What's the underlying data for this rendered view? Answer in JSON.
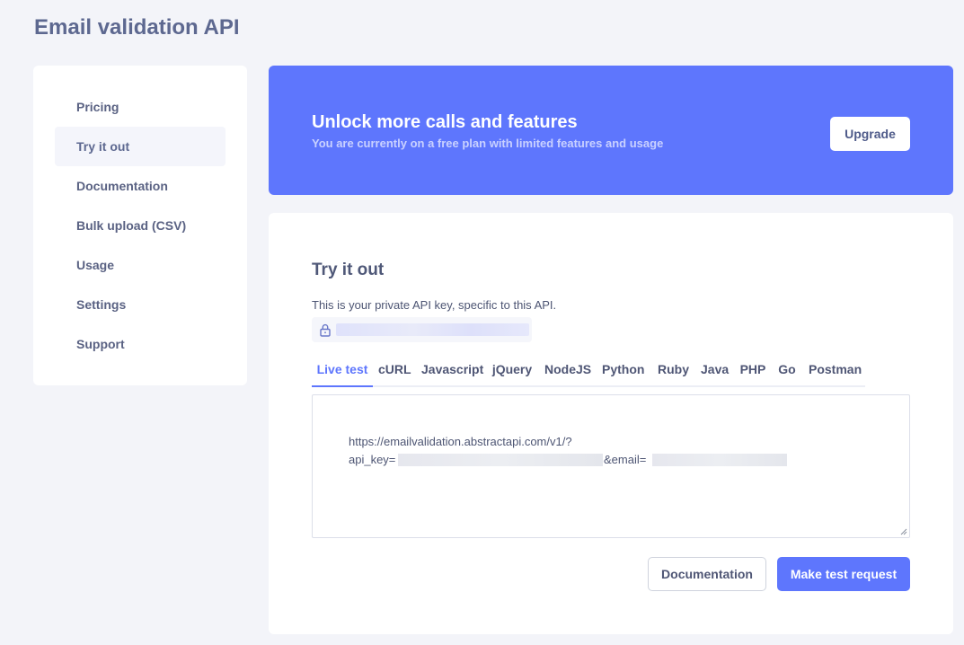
{
  "page": {
    "title": "Email validation API"
  },
  "sidebar": {
    "items": [
      {
        "label": "Pricing",
        "active": false
      },
      {
        "label": "Try it out",
        "active": true
      },
      {
        "label": "Documentation",
        "active": false
      },
      {
        "label": "Bulk upload (CSV)",
        "active": false
      },
      {
        "label": "Usage",
        "active": false
      },
      {
        "label": "Settings",
        "active": false
      },
      {
        "label": "Support",
        "active": false
      }
    ]
  },
  "banner": {
    "title": "Unlock more calls and features",
    "subtitle": "You are currently on a free plan with limited features and usage",
    "upgrade_label": "Upgrade"
  },
  "try_it_out": {
    "title": "Try it out",
    "description": "This is your private API key, specific to this API.",
    "tabs": [
      "Live test",
      "cURL",
      "Javascript",
      "jQuery",
      "NodeJS",
      "Python",
      "Ruby",
      "Java",
      "PHP",
      "Go",
      "Postman"
    ],
    "active_tab": "Live test",
    "code": {
      "line1": "https://emailvalidation.abstractapi.com/v1/?",
      "api_key_prefix": "api_key=",
      "email_param": "&email="
    },
    "documentation_label": "Documentation",
    "test_request_label": "Make test request"
  },
  "colors": {
    "accent": "#5e76fd",
    "background": "#f3f4f9",
    "card": "#ffffff"
  },
  "icons": [
    "lock-icon",
    "resize-handle-icon"
  ]
}
